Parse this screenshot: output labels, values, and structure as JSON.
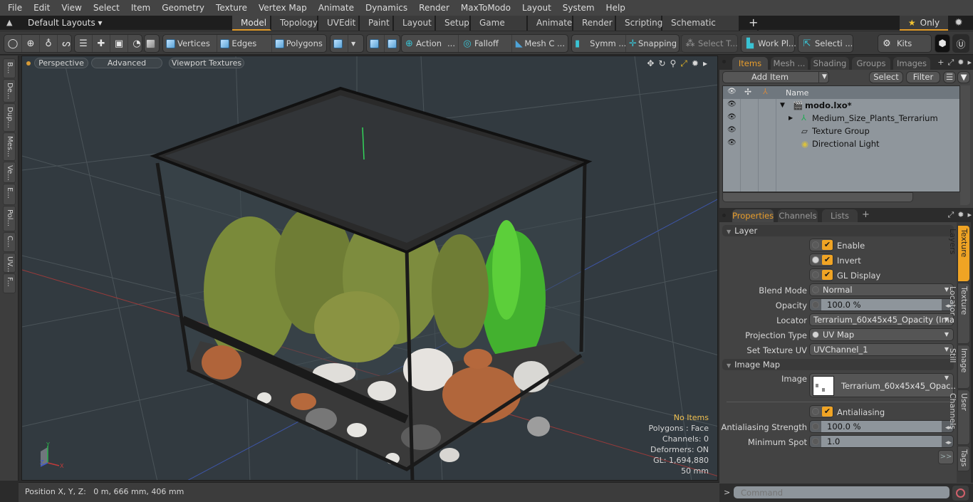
{
  "menubar": {
    "items": [
      "File",
      "Edit",
      "View",
      "Select",
      "Item",
      "Geometry",
      "Texture",
      "Vertex Map",
      "Animate",
      "Dynamics",
      "Render",
      "MaxToModo",
      "Layout",
      "System",
      "Help"
    ]
  },
  "layoutbar": {
    "layouts_label": "Default Layouts ▾",
    "tabs": [
      {
        "label": "Model",
        "active": true
      },
      {
        "label": "Topology"
      },
      {
        "label": "UVEdit"
      },
      {
        "label": "Paint"
      },
      {
        "label": "Layout"
      },
      {
        "label": "Setup"
      },
      {
        "label": "Game Tools"
      },
      {
        "label": "Animate"
      },
      {
        "label": "Render"
      },
      {
        "label": "Scripting"
      },
      {
        "label": "Schematic Fusion"
      }
    ],
    "add_tab": "+",
    "only_label": "Only",
    "star_icon": "★"
  },
  "toolbar": {
    "vertices": "Vertices",
    "edges": "Edges",
    "polygons": "Polygons",
    "action": "Action",
    "action_more": "...",
    "falloff": "Falloff",
    "mesh_c": "Mesh C ...",
    "symm": "Symm ...",
    "snapping": "Snapping",
    "select_t": "Select T...",
    "work_pl": "Work Pl...",
    "selecti": "Selecti ...",
    "kits": "Kits"
  },
  "leftstrip": {
    "tabs": [
      "B...",
      "De...",
      "Dup...",
      "Mes...",
      "Ve...",
      "E...",
      "Pol...",
      "C...",
      "UV...",
      "F..."
    ]
  },
  "viewport": {
    "perspective": "Perspective",
    "advanced": "Advanced",
    "viewport_textures": "Viewport Textures",
    "hud": {
      "selection": "No Items",
      "polygons": "Polygons : Face",
      "channels": "Channels: 0",
      "deformers": "Deformers: ON",
      "gl": "GL: 1,694,880",
      "focal": "50 mm"
    },
    "axis": {
      "x": "X",
      "y": "Y",
      "z": "Z"
    }
  },
  "statusbar": {
    "position": "Position X, Y, Z:   0 m, 666 mm, 406 mm"
  },
  "items_panel": {
    "tabs": [
      {
        "label": "Items",
        "active": true
      },
      {
        "label": "Mesh ..."
      },
      {
        "label": "Shading"
      },
      {
        "label": "Groups"
      },
      {
        "label": "Images"
      }
    ],
    "add_item": "Add Item",
    "select": "Select",
    "filter": "Filter",
    "name_header": "Name",
    "tree": [
      {
        "label": "modo.lxo*",
        "level": 0,
        "icon": "scene-icon",
        "bold": true,
        "expanded": true
      },
      {
        "label": "Medium_Size_Plants_Terrarium",
        "level": 1,
        "icon": "locator-icon",
        "collapsed": true
      },
      {
        "label": "Texture Group",
        "level": 1,
        "icon": "folder-icon"
      },
      {
        "label": "Directional Light",
        "level": 1,
        "icon": "light-icon"
      }
    ]
  },
  "properties_panel": {
    "tabs": [
      {
        "label": "Properties",
        "active": true
      },
      {
        "label": "Channels"
      },
      {
        "label": "Lists"
      }
    ],
    "layer_section": "Layer",
    "enable": {
      "label": "Enable",
      "checked": true
    },
    "invert": {
      "label": "Invert",
      "checked": true
    },
    "gl_display": {
      "label": "GL Display",
      "checked": true
    },
    "blend_mode": {
      "label": "Blend Mode",
      "value": "Normal"
    },
    "opacity": {
      "label": "Opacity",
      "value": "100.0 %"
    },
    "locator": {
      "label": "Locator",
      "value": "Terrarium_60x45x45_Opacity (Ima ..."
    },
    "projection_type": {
      "label": "Projection Type",
      "value": "UV Map"
    },
    "set_texture_uv": {
      "label": "Set Texture UV",
      "value": "UVChannel_1"
    },
    "image_map_section": "Image Map",
    "image": {
      "label": "Image",
      "value": "Terrarium_60x45x45_Opac..."
    },
    "antialiasing": {
      "label": "Antialiasing",
      "checked": true
    },
    "antialiasing_strength": {
      "label": "Antialiasing Strength",
      "value": "100.0 %"
    },
    "minimum_spot": {
      "label": "Minimum Spot",
      "value": "1.0"
    },
    "more": ">>",
    "side_tabs": [
      {
        "label": "Texture Layers",
        "active": true
      },
      {
        "label": "Texture Locator"
      },
      {
        "label": "Image Still"
      },
      {
        "label": "User Channels"
      },
      {
        "label": "Tags"
      }
    ]
  },
  "command": {
    "prompt": ">",
    "placeholder": "Command"
  },
  "colors": {
    "accent": "#e89d2c",
    "checkbox": "#f0a424",
    "viewport_bg": "#323a40"
  }
}
